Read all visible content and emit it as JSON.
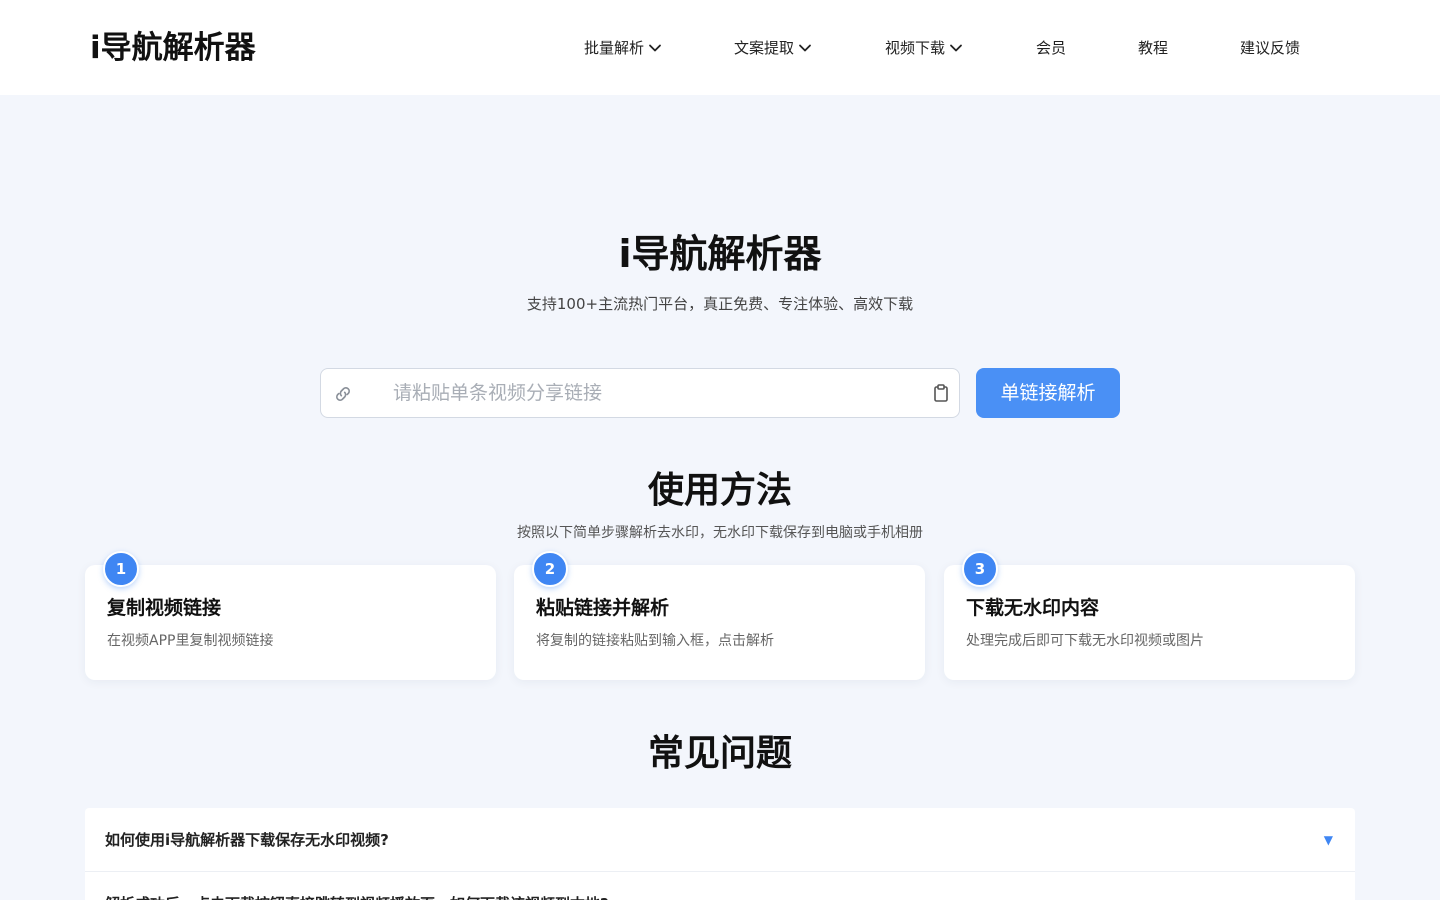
{
  "header": {
    "logo": "i导航解析器",
    "nav": [
      {
        "label": "批量解析",
        "has_dropdown": true
      },
      {
        "label": "文案提取",
        "has_dropdown": true
      },
      {
        "label": "视频下载",
        "has_dropdown": true
      },
      {
        "label": "会员",
        "has_dropdown": false
      },
      {
        "label": "教程",
        "has_dropdown": false
      },
      {
        "label": "建议反馈",
        "has_dropdown": false
      }
    ]
  },
  "hero": {
    "title": "i导航解析器",
    "subtitle": "支持100+主流热门平台，真正免费、专注体验、高效下载",
    "search_placeholder": "请粘贴单条视频分享链接",
    "search_value": "",
    "button_label": "单链接解析"
  },
  "usage": {
    "title": "使用方法",
    "subtitle": "按照以下简单步骤解析去水印，无水印下载保存到电脑或手机相册",
    "steps": [
      {
        "number": "1",
        "title": "复制视频链接",
        "desc": "在视频APP里复制视频链接"
      },
      {
        "number": "2",
        "title": "粘贴链接并解析",
        "desc": "将复制的链接粘贴到输入框，点击解析"
      },
      {
        "number": "3",
        "title": "下载无水印内容",
        "desc": "处理完成后即可下载无水印视频或图片"
      }
    ]
  },
  "faq": {
    "title": "常见问题",
    "items": [
      {
        "question": "如何使用i导航解析器下载保存无水印视频?",
        "arrow": "▼"
      },
      {
        "question": "解析成功后，点击下载按钮直接跳转到视频播放页，如何下载该视频到本地?",
        "arrow": "▼"
      }
    ]
  },
  "colors": {
    "accent": "#4a90f5",
    "badge": "#3f86f3",
    "page_bg": "#f3f6fc"
  }
}
